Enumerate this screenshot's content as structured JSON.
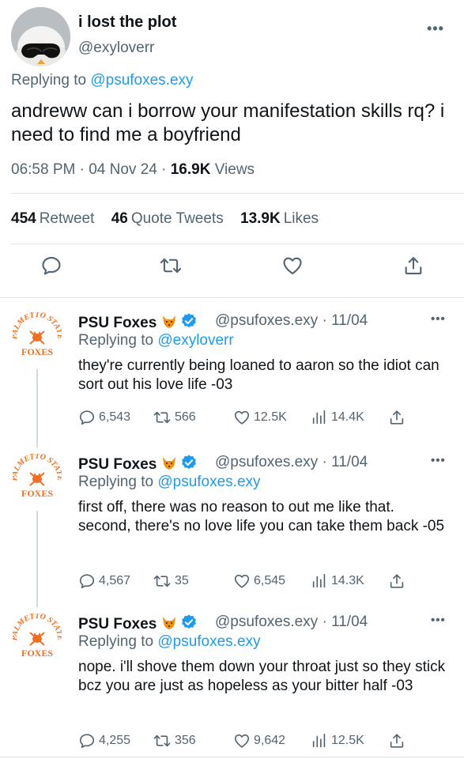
{
  "main_tweet": {
    "author_name": "i lost the plot",
    "author_handle": "@exyloverr",
    "replying_prefix": "Replying to",
    "replying_to": "@psufoxes.exy",
    "text": "andreww can i borrow your manifestation skills rq? i need to find me a boyfriend",
    "time": "06:58 PM",
    "date": "04 Nov 24",
    "views_count": "16.9K",
    "views_label": "Views",
    "retweets_count": "454",
    "retweets_label": "Retweet",
    "quotes_count": "46",
    "quotes_label": "Quote Tweets",
    "likes_count": "13.9K",
    "likes_label": "Likes"
  },
  "replies": [
    {
      "name": "PSU Foxes",
      "handle": "@psufoxes.exy",
      "date": "11/04",
      "replying_prefix": "Replying to",
      "replying_to": "@exyloverr",
      "text": "they're currently being loaned to aaron so the idiot can sort out his love life -03",
      "replies": "6,543",
      "retweets": "566",
      "likes": "12.5K",
      "views": "14.4K"
    },
    {
      "name": "PSU Foxes",
      "handle": "@psufoxes.exy",
      "date": "11/04",
      "replying_prefix": "Replying to",
      "replying_to": "@psufoxes.exy",
      "text": "first off, there was no reason to out me like that. second, there's no love life you can take them back -05",
      "replies": "4,567",
      "retweets": "35",
      "likes": "6,545",
      "views": "14.3K"
    },
    {
      "name": "PSU Foxes",
      "handle": "@psufoxes.exy",
      "date": "11/04",
      "replying_prefix": "Replying to",
      "replying_to": "@psufoxes.exy",
      "text": "nope. i'll shove them down your throat just so they stick bcz you are just as hopeless as your bitter half -03",
      "replies": "4,255",
      "retweets": "356",
      "likes": "9,642",
      "views": "12.5K"
    }
  ],
  "logo_text": {
    "arc": "PALMETTO STATE",
    "word": "FOXES"
  },
  "icons": {
    "more": "more-dots-icon",
    "reply": "reply-bubble-icon",
    "retweet": "retweet-icon",
    "like": "heart-icon",
    "share": "share-icon",
    "views": "views-bars-icon",
    "verified": "verified-badge-icon",
    "fox": "fox-emoji-icon"
  },
  "colors": {
    "link": "#1d9bf0",
    "muted": "#536471",
    "logo_orange": "#f26f21"
  }
}
